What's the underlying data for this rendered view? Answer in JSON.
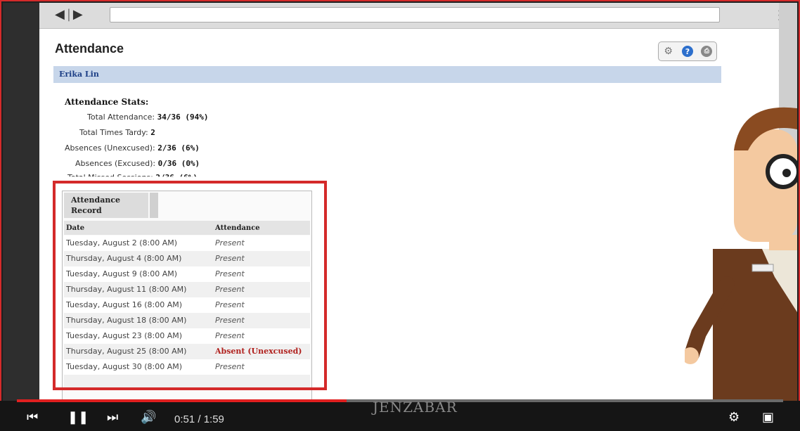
{
  "window": {
    "url": ""
  },
  "page": {
    "title": "Attendance",
    "student": "Erika Lin",
    "stats_title": "Attendance Stats:",
    "stats": [
      {
        "label": "Total Attendance:",
        "value": "34/36 (94%)"
      },
      {
        "label": "Total Times Tardy:",
        "value": "2"
      },
      {
        "label": "Absences (Unexcused):",
        "value": "2/36 (6%)"
      },
      {
        "label": "Absences (Excused):",
        "value": "0/36 (0%)"
      },
      {
        "label": "Total Missed Sessions:",
        "value": "2/36 (6%)"
      }
    ],
    "record_tab": "Attendance Record",
    "columns": {
      "date": "Date",
      "attendance": "Attendance"
    },
    "rows": [
      {
        "date": "Tuesday, August 2 (8:00 AM)",
        "status": "Present"
      },
      {
        "date": "Thursday, August 4 (8:00 AM)",
        "status": "Present"
      },
      {
        "date": "Tuesday, August 9 (8:00 AM)",
        "status": "Present"
      },
      {
        "date": "Thursday, August 11 (8:00 AM)",
        "status": "Present"
      },
      {
        "date": "Tuesday, August 16 (8:00 AM)",
        "status": "Present"
      },
      {
        "date": "Thursday, August 18 (8:00 AM)",
        "status": "Present"
      },
      {
        "date": "Tuesday, August 23 (8:00 AM)",
        "status": "Present"
      },
      {
        "date": "Thursday, August 25 (8:00 AM)",
        "status": "Absent (Unexcused)"
      },
      {
        "date": "Tuesday, August 30 (8:00 AM)",
        "status": "Present"
      }
    ]
  },
  "icons": {
    "settings": "gear-icon",
    "help": "help-icon",
    "print": "print-icon"
  },
  "player": {
    "time": "0:51 / 1:59",
    "progress": 0.43,
    "brand": "JENZABAR",
    "colors": {
      "progress": "#e02020",
      "highlight": "#d42a2a"
    }
  }
}
